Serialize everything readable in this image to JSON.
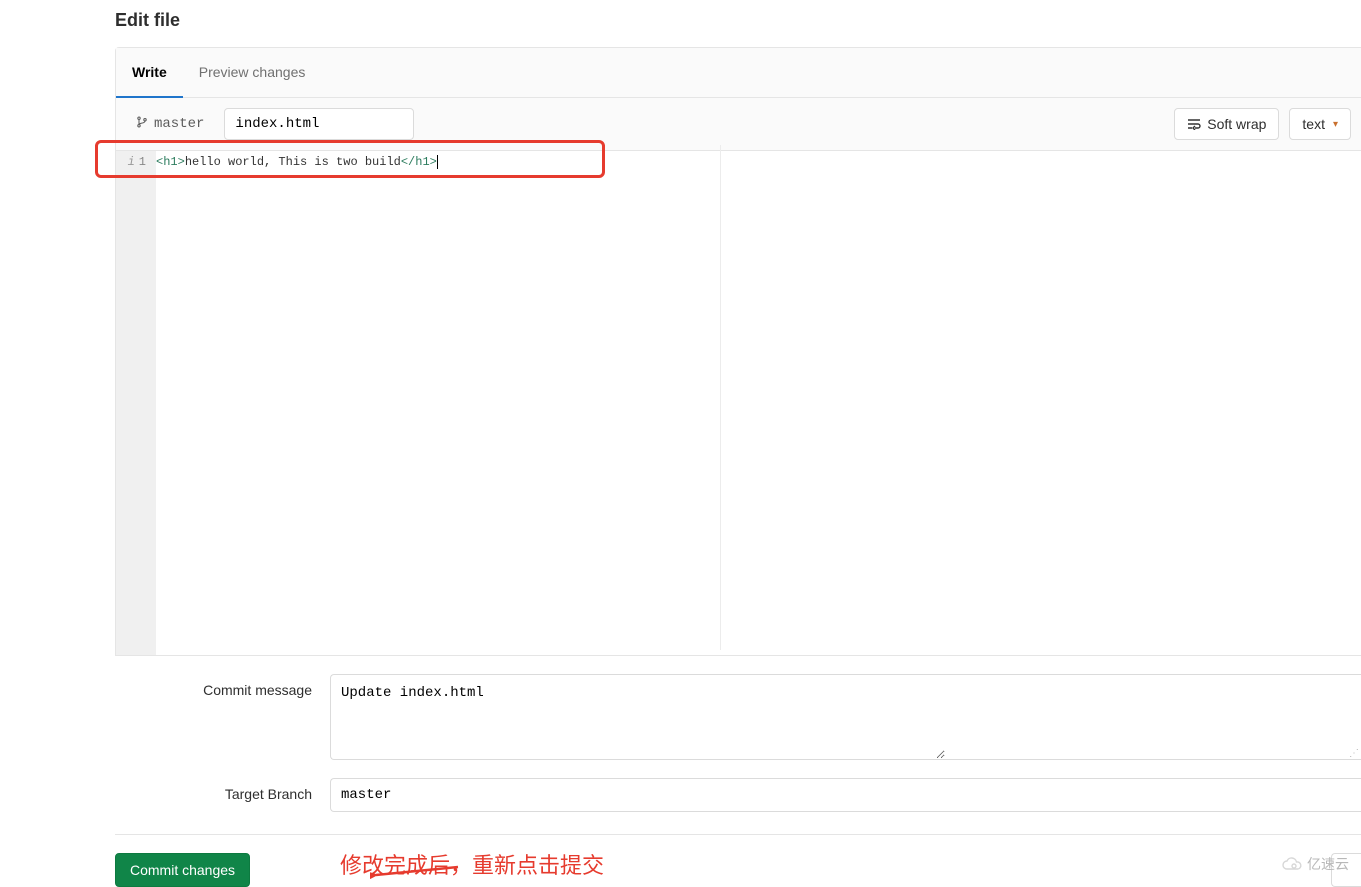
{
  "page": {
    "title": "Edit file"
  },
  "tabs": {
    "write": "Write",
    "preview": "Preview changes"
  },
  "branch": {
    "name": "master"
  },
  "filename": {
    "value": "index.html"
  },
  "toolbar": {
    "soft_wrap": "Soft wrap",
    "syntax": "text"
  },
  "editor": {
    "line_number": "1",
    "code": {
      "open_tag": "<h1>",
      "text": "hello world, This is two build",
      "close_tag": "</h1>"
    }
  },
  "form": {
    "commit_message_label": "Commit message",
    "commit_message_value": "Update index.html",
    "target_branch_label": "Target Branch",
    "target_branch_value": "master"
  },
  "actions": {
    "commit": "Commit changes"
  },
  "annotation": {
    "text": "修改完成后，重新点击提交"
  },
  "watermark": {
    "text": "亿速云"
  }
}
